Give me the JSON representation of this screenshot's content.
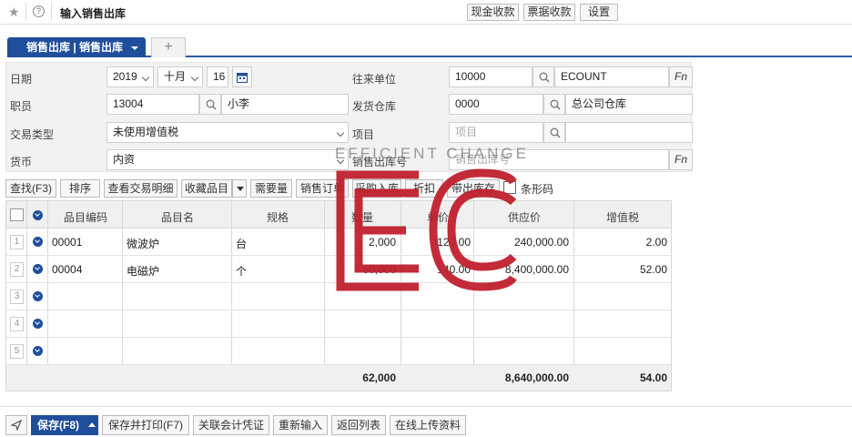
{
  "header": {
    "title": "输入销售出库",
    "buttons": [
      "现金收款",
      "票据收款",
      "设置"
    ]
  },
  "tabs": {
    "active": "销售出库 | 销售出库",
    "add": "+"
  },
  "form": {
    "date_label": "日期",
    "year": "2019",
    "month": "十月",
    "day": "16",
    "partner_label": "往来单位",
    "partner_code": "10000",
    "partner_name": "ECOUNT",
    "staff_label": "职员",
    "staff_code": "13004",
    "staff_name": "小李",
    "warehouse_label": "发货仓库",
    "warehouse_code": "0000",
    "warehouse_name": "总公司仓库",
    "trade_type_label": "交易类型",
    "trade_type": "未使用增值税",
    "project_label": "项目",
    "project_placeholder": "项目",
    "currency_label": "货币",
    "currency": "内资",
    "doc_no_label": "销售出库号",
    "doc_no_placeholder": "销售出库号",
    "fn": "Fn"
  },
  "toolbar": {
    "buttons": [
      "查找(F3)",
      "排序",
      "查看交易明细",
      "收藏品目",
      "需要量",
      "销售订单",
      "采购入库",
      "折扣",
      "带出库存"
    ],
    "barcode": "条形码"
  },
  "grid": {
    "columns": [
      "品目编码",
      "品目名",
      "规格",
      "数量",
      "单价",
      "供应价",
      "增值税"
    ],
    "rows": [
      {
        "no": "1",
        "code": "00001",
        "name": "微波炉",
        "spec": "台",
        "qty": "2,000",
        "price": "120.00",
        "supply": "240,000.00",
        "vat": "2.00"
      },
      {
        "no": "2",
        "code": "00004",
        "name": "电磁炉",
        "spec": "个",
        "qty": "60,000",
        "price": "140.00",
        "supply": "8,400,000.00",
        "vat": "52.00"
      },
      {
        "no": "3"
      },
      {
        "no": "4"
      },
      {
        "no": "5"
      }
    ],
    "totals": {
      "qty": "62,000",
      "supply": "8,640,000.00",
      "vat": "54.00"
    }
  },
  "footer": {
    "save": "保存(F8)",
    "buttons": [
      "保存并打印(F7)",
      "关联会计凭证",
      "重新输入",
      "返回列表",
      "在线上传资料"
    ]
  },
  "watermark": {
    "text": "EFFICIENT CHANGE",
    "color": "#c0202e"
  }
}
